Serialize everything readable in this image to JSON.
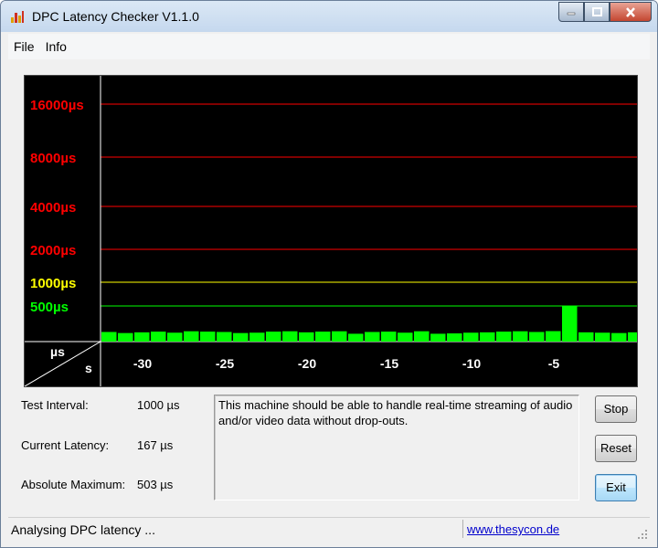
{
  "window": {
    "title": "DPC Latency Checker V1.1.0"
  },
  "menu": {
    "items": [
      "File",
      "Info"
    ]
  },
  "graph": {
    "y_unit_label": "µs",
    "x_unit_label": "s",
    "threshold_lines": [
      {
        "label": "16000µs",
        "value": 16000,
        "color": "#ff0000"
      },
      {
        "label": "8000µs",
        "value": 8000,
        "color": "#ff0000"
      },
      {
        "label": "4000µs",
        "value": 4000,
        "color": "#ff0000"
      },
      {
        "label": "2000µs",
        "value": 2000,
        "color": "#ff0000"
      },
      {
        "label": "1000µs",
        "value": 1000,
        "color": "#ffff00"
      },
      {
        "label": "500µs",
        "value": 500,
        "color": "#00ff00"
      }
    ],
    "x_ticks": [
      "-30",
      "-25",
      "-20",
      "-15",
      "-10",
      "-5"
    ],
    "bar_color": "#00ff00",
    "bar_values": [
      135,
      120,
      130,
      140,
      125,
      145,
      140,
      135,
      120,
      125,
      140,
      145,
      130,
      140,
      145,
      110,
      135,
      140,
      125,
      145,
      110,
      115,
      125,
      130,
      140,
      145,
      135,
      147,
      503,
      130,
      125,
      120,
      130,
      160,
      140,
      135,
      118
    ]
  },
  "info": {
    "test_interval_label": "Test Interval:",
    "test_interval_value": "1000 µs",
    "current_latency_label": "Current Latency:",
    "current_latency_value": "167 µs",
    "absolute_max_label": "Absolute Maximum:",
    "absolute_max_value": "503 µs"
  },
  "message": "This machine should be able to handle real-time streaming of audio and/or video data without drop-outs.",
  "buttons": {
    "stop": "Stop",
    "reset": "Reset",
    "exit": "Exit"
  },
  "status": {
    "text": "Analysing DPC latency ...",
    "link": "www.thesycon.de"
  }
}
